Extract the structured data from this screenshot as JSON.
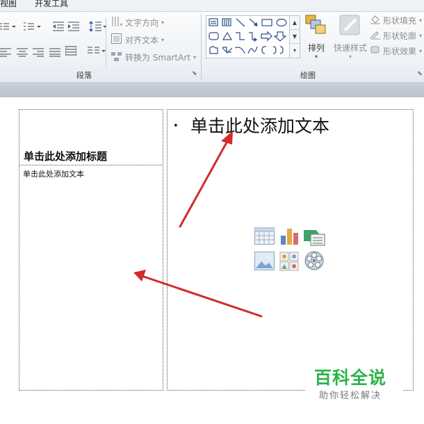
{
  "ribbon": {
    "tabs": [
      "视图",
      "开发工具"
    ],
    "paragraph": {
      "text_direction": "文字方向",
      "align_text": "对齐文本",
      "convert_smartart": "转换为 SmartArt",
      "group_label": "段落"
    },
    "drawing": {
      "arrange": "排列",
      "quick_styles": "快速样式",
      "shape_fill": "形状填充",
      "shape_outline": "形状轮廓",
      "shape_effects": "形状效果",
      "group_label": "绘图"
    }
  },
  "slide": {
    "left_title": "单击此处添加标题",
    "left_text": "单击此处添加文本",
    "right_bullet": "单击此处添加文本"
  },
  "watermark": {
    "title": "百科全说",
    "subtitle": "助你轻松解决"
  },
  "colors": {
    "arrow": "#d12b2b",
    "watermark_green": "#2db34a"
  }
}
